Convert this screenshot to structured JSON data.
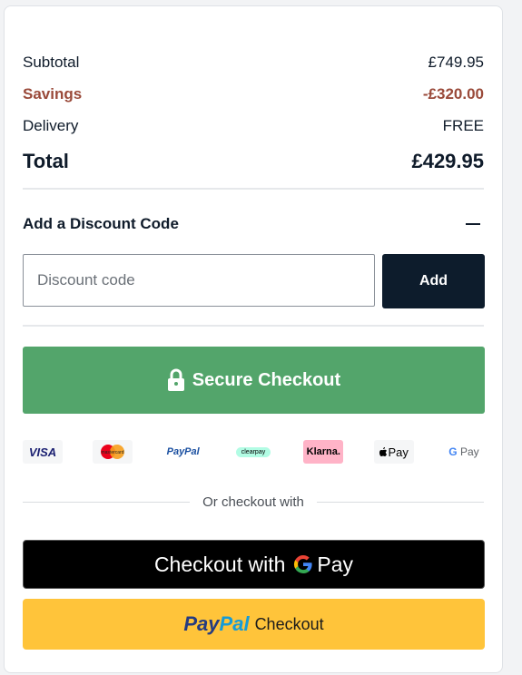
{
  "summary": {
    "subtotal_label": "Subtotal",
    "subtotal_value": "£749.95",
    "savings_label": "Savings",
    "savings_value": "-£320.00",
    "delivery_label": "Delivery",
    "delivery_value": "FREE",
    "total_label": "Total",
    "total_value": "£429.95"
  },
  "discount": {
    "heading": "Add a Discount Code",
    "placeholder": "Discount code",
    "value": "",
    "add_label": "Add"
  },
  "checkout": {
    "secure_label": "Secure Checkout",
    "button_color": "#53a56b"
  },
  "payment_methods": {
    "visa": "VISA",
    "mastercard": "mastercard",
    "paypal": "PayPal",
    "clearpay": "clearpay",
    "klarna": "Klarna.",
    "applepay": "Pay",
    "gpay": "Pay"
  },
  "alt_checkout": {
    "or_text": "Or checkout with",
    "gpay_label": "Checkout with",
    "gpay_g": "G",
    "gpay_pay": "Pay",
    "paypal_a": "Pay",
    "paypal_b": "Pal",
    "paypal_text": "Checkout"
  },
  "colors": {
    "savings": "#9a4a3a",
    "dark_button": "#0d1c2c",
    "paypal_yellow": "#ffc43a"
  }
}
